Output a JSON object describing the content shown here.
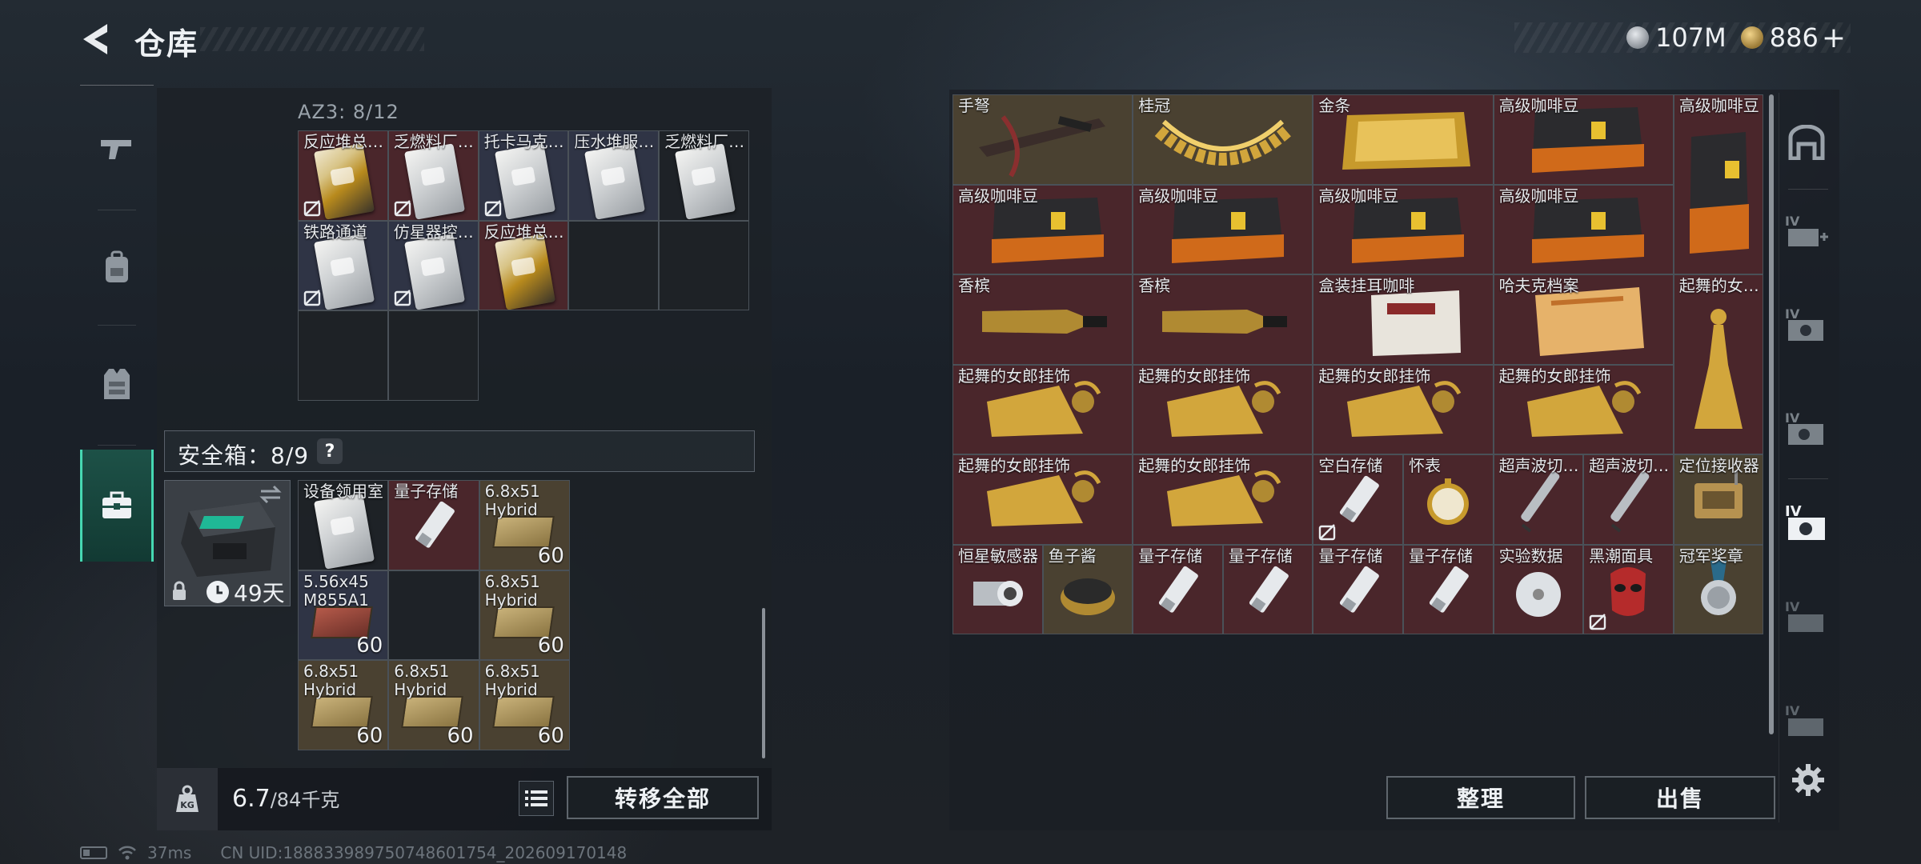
{
  "header": {
    "title": "仓库",
    "back_icon": "back-arrow-icon",
    "currency": {
      "silver": "107M",
      "gold": "886",
      "plus": "+"
    }
  },
  "left_nav": {
    "items": [
      "gun-icon",
      "backpack-icon",
      "vest-icon",
      "briefcase-icon"
    ],
    "active": 3
  },
  "container": {
    "label": "AZ3: 8/12",
    "items": [
      {
        "name": "反应堆总…",
        "bg": "red",
        "art": "card-gold",
        "locked": true
      },
      {
        "name": "乏燃料厂…",
        "bg": "red",
        "art": "card-white",
        "locked": true
      },
      {
        "name": "托卡马克…",
        "bg": "blue",
        "art": "card-white",
        "locked": true
      },
      {
        "name": "压水堆服…",
        "bg": "blue",
        "art": "card-white",
        "locked": false
      },
      {
        "name": "乏燃料厂…",
        "bg": "dark",
        "art": "card-white",
        "locked": false
      },
      {
        "name": "铁路通道",
        "bg": "blue",
        "art": "card-white",
        "locked": true
      },
      {
        "name": "仿星器控…",
        "bg": "blue",
        "art": "card-white",
        "locked": true
      },
      {
        "name": "反应堆总…",
        "bg": "red",
        "art": "card-gold",
        "locked": false
      }
    ]
  },
  "safe": {
    "title": "安全箱：8/9",
    "help": "?",
    "days": "49天",
    "items": [
      {
        "name": "设备领用室",
        "bg": "dark",
        "art": "card-white",
        "count": ""
      },
      {
        "name": "量子存储",
        "bg": "red",
        "art": "drive",
        "count": ""
      },
      {
        "name": "6.8x51 Hybrid",
        "bg": "tan",
        "art": "ammo",
        "count": "60"
      },
      {
        "name": "5.56x45 M855A1",
        "bg": "blue",
        "art": "ammo-red",
        "count": "60"
      },
      {
        "name": "",
        "bg": "dark",
        "art": "",
        "count": ""
      },
      {
        "name": "6.8x51 Hybrid",
        "bg": "tan",
        "art": "ammo",
        "count": "60"
      },
      {
        "name": "6.8x51 Hybrid",
        "bg": "tan",
        "art": "ammo",
        "count": "60"
      },
      {
        "name": "6.8x51 Hybrid",
        "bg": "tan",
        "art": "ammo",
        "count": "60"
      },
      {
        "name": "6.8x51 Hybrid",
        "bg": "tan",
        "art": "ammo",
        "count": "60"
      }
    ]
  },
  "weight": {
    "current": "6.7",
    "max": "/84千克"
  },
  "buttons": {
    "transfer_all": "转移全部",
    "sort": "整理",
    "sell": "出售"
  },
  "stash": {
    "items": [
      {
        "name": "手弩",
        "row": 1,
        "col": 1,
        "w": 2,
        "h": 1,
        "bg": "tan",
        "art": "crossbow"
      },
      {
        "name": "桂冠",
        "row": 1,
        "col": 3,
        "w": 2,
        "h": 1,
        "bg": "tan",
        "art": "laurel"
      },
      {
        "name": "金条",
        "row": 1,
        "col": 5,
        "w": 2,
        "h": 1,
        "bg": "red",
        "art": "goldbar"
      },
      {
        "name": "高级咖啡豆",
        "row": 1,
        "col": 7,
        "w": 2,
        "h": 1,
        "bg": "red",
        "art": "coffee"
      },
      {
        "name": "高级咖啡豆",
        "row": 1,
        "col": 9,
        "w": 1,
        "h": 2,
        "bg": "red",
        "art": "coffee-tall"
      },
      {
        "name": "高级咖啡豆",
        "row": 2,
        "col": 1,
        "w": 2,
        "h": 1,
        "bg": "red",
        "art": "coffee"
      },
      {
        "name": "高级咖啡豆",
        "row": 2,
        "col": 3,
        "w": 2,
        "h": 1,
        "bg": "red",
        "art": "coffee"
      },
      {
        "name": "高级咖啡豆",
        "row": 2,
        "col": 5,
        "w": 2,
        "h": 1,
        "bg": "red",
        "art": "coffee"
      },
      {
        "name": "高级咖啡豆",
        "row": 2,
        "col": 7,
        "w": 2,
        "h": 1,
        "bg": "red",
        "art": "coffee"
      },
      {
        "name": "香槟",
        "row": 3,
        "col": 1,
        "w": 2,
        "h": 1,
        "bg": "red",
        "art": "champagne"
      },
      {
        "name": "香槟",
        "row": 3,
        "col": 3,
        "w": 2,
        "h": 1,
        "bg": "red",
        "art": "champagne"
      },
      {
        "name": "盒装挂耳咖啡",
        "row": 3,
        "col": 5,
        "w": 2,
        "h": 1,
        "bg": "red",
        "art": "coffeebox"
      },
      {
        "name": "哈夫克档案",
        "row": 3,
        "col": 7,
        "w": 2,
        "h": 1,
        "bg": "red",
        "art": "file"
      },
      {
        "name": "起舞的女…",
        "row": 3,
        "col": 9,
        "w": 1,
        "h": 2,
        "bg": "red",
        "art": "dancer-tall"
      },
      {
        "name": "起舞的女郎挂饰",
        "row": 4,
        "col": 1,
        "w": 2,
        "h": 1,
        "bg": "red",
        "art": "dancer"
      },
      {
        "name": "起舞的女郎挂饰",
        "row": 4,
        "col": 3,
        "w": 2,
        "h": 1,
        "bg": "red",
        "art": "dancer"
      },
      {
        "name": "起舞的女郎挂饰",
        "row": 4,
        "col": 5,
        "w": 2,
        "h": 1,
        "bg": "red",
        "art": "dancer"
      },
      {
        "name": "起舞的女郎挂饰",
        "row": 4,
        "col": 7,
        "w": 2,
        "h": 1,
        "bg": "red",
        "art": "dancer"
      },
      {
        "name": "起舞的女郎挂饰",
        "row": 5,
        "col": 1,
        "w": 2,
        "h": 1,
        "bg": "red",
        "art": "dancer"
      },
      {
        "name": "起舞的女郎挂饰",
        "row": 5,
        "col": 3,
        "w": 2,
        "h": 1,
        "bg": "red",
        "art": "dancer"
      },
      {
        "name": "空白存储",
        "row": 5,
        "col": 5,
        "w": 1,
        "h": 1,
        "bg": "red",
        "art": "drive",
        "locked": true
      },
      {
        "name": "怀表",
        "row": 5,
        "col": 6,
        "w": 1,
        "h": 1,
        "bg": "red",
        "art": "watch"
      },
      {
        "name": "超声波切…",
        "row": 5,
        "col": 7,
        "w": 1,
        "h": 1,
        "bg": "red",
        "art": "pen"
      },
      {
        "name": "超声波切…",
        "row": 5,
        "col": 8,
        "w": 1,
        "h": 1,
        "bg": "red",
        "art": "pen"
      },
      {
        "name": "定位接收器",
        "row": 5,
        "col": 9,
        "w": 1,
        "h": 1,
        "bg": "tan",
        "art": "receiver"
      },
      {
        "name": "恒星敏感器",
        "row": 6,
        "col": 1,
        "w": 1,
        "h": 1,
        "bg": "red",
        "art": "sensor"
      },
      {
        "name": "鱼子酱",
        "row": 6,
        "col": 2,
        "w": 1,
        "h": 1,
        "bg": "tan",
        "art": "caviar"
      },
      {
        "name": "量子存储",
        "row": 6,
        "col": 3,
        "w": 1,
        "h": 1,
        "bg": "red",
        "art": "drive"
      },
      {
        "name": "量子存储",
        "row": 6,
        "col": 4,
        "w": 1,
        "h": 1,
        "bg": "red",
        "art": "drive"
      },
      {
        "name": "量子存储",
        "row": 6,
        "col": 5,
        "w": 1,
        "h": 1,
        "bg": "red",
        "art": "drive"
      },
      {
        "name": "量子存储",
        "row": 6,
        "col": 6,
        "w": 1,
        "h": 1,
        "bg": "red",
        "art": "drive"
      },
      {
        "name": "实验数据",
        "row": 6,
        "col": 7,
        "w": 1,
        "h": 1,
        "bg": "red",
        "art": "disc"
      },
      {
        "name": "黑潮面具",
        "row": 6,
        "col": 8,
        "w": 1,
        "h": 1,
        "bg": "red",
        "art": "mask",
        "locked": true
      },
      {
        "name": "冠军奖章",
        "row": 6,
        "col": 9,
        "w": 1,
        "h": 1,
        "bg": "tan",
        "art": "medal"
      }
    ]
  },
  "right_nav": {
    "items": [
      "home-icon",
      "case-add-icon",
      "case-1-icon",
      "case-2-icon",
      "case-active-icon",
      "case-3-icon",
      "case-4-icon"
    ],
    "active": 4,
    "settings": "gear-icon"
  },
  "status": {
    "ping": "37ms",
    "uid": "CN UID:1888339897507486017​54_202609170148"
  },
  "colors": {
    "accent": "#46d8b2",
    "cell_red": "#4a262b",
    "cell_tan": "#4a4131",
    "cell_blue": "#2f3445"
  }
}
